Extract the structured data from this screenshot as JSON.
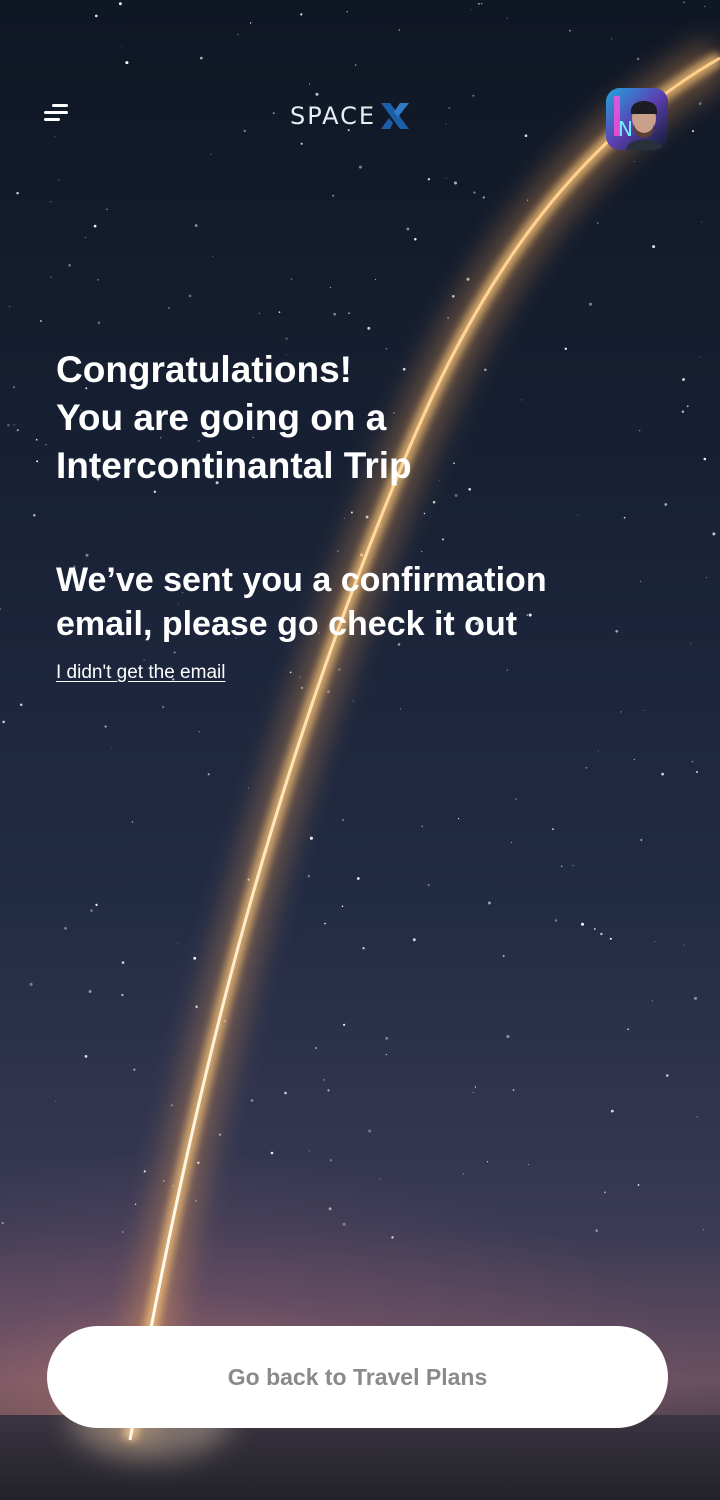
{
  "header": {
    "menu_icon": "menu-icon",
    "logo_text": "SPACE",
    "logo_mark": "X",
    "avatar_icon": "user-avatar"
  },
  "main": {
    "headline_lines": [
      "Congratulations!",
      "You are going on a",
      "Intercontinantal Trip"
    ],
    "subhead_lines": [
      "We’ve sent you a confirmation",
      "email, please go check it out"
    ],
    "resend_link": "I didn't get the email"
  },
  "footer": {
    "cta_label": "Go back to Travel Plans"
  },
  "colors": {
    "logo_x": "#1a5fa8",
    "cta_text": "#8a8a8a",
    "cta_bg": "#ffffff"
  }
}
